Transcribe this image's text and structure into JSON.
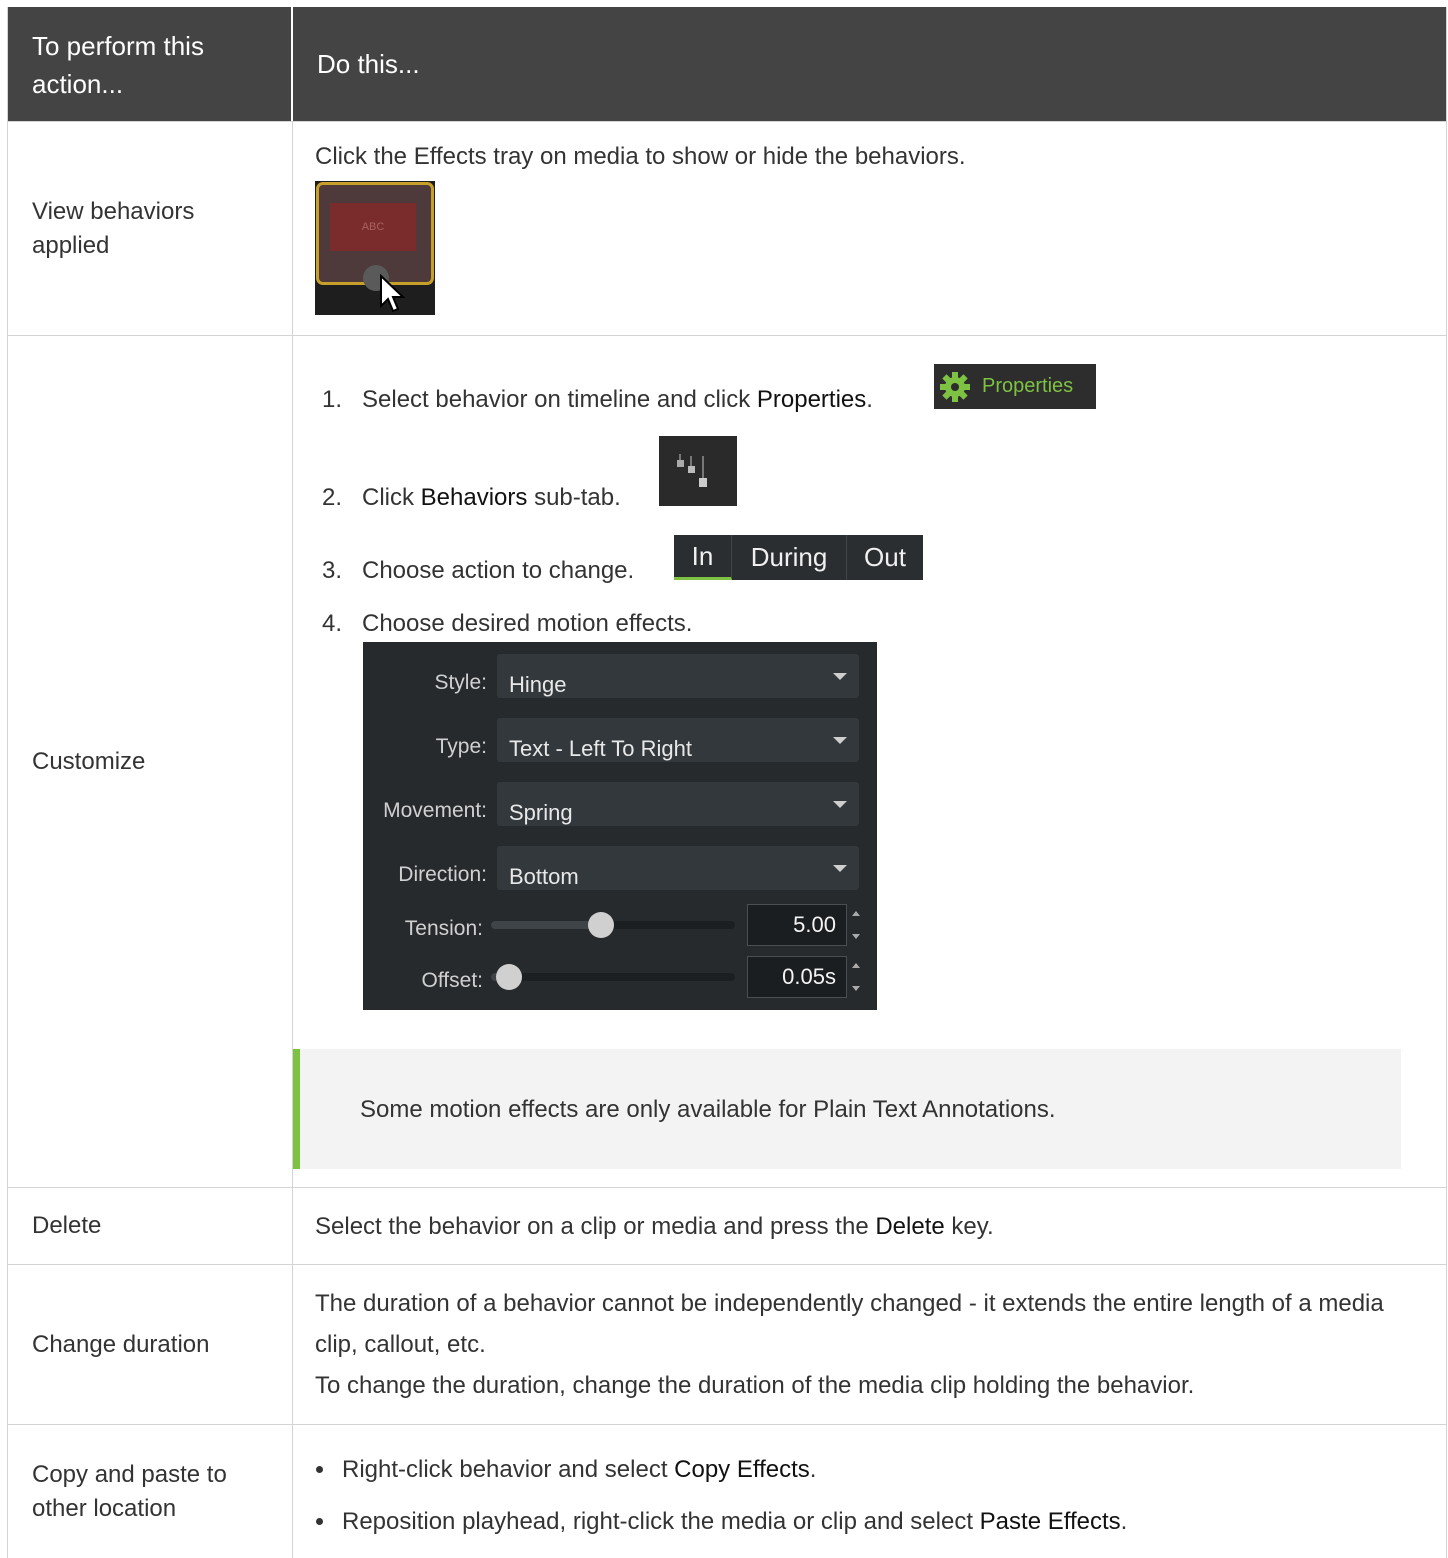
{
  "header": {
    "col1": "To perform this action...",
    "col2": "Do this..."
  },
  "rows": [
    {
      "action": "View behaviors applied",
      "desc": "Click the Effects tray on media to show or hide the behaviors.",
      "thumb_text": "ABC"
    },
    {
      "action": "Customize",
      "steps": [
        {
          "num": "1.",
          "pre": "Select behavior on timeline and click ",
          "bold": "Properties",
          "post": "."
        },
        {
          "num": "2.",
          "pre": "Click ",
          "bold": "Behaviors",
          "post": " sub-tab."
        },
        {
          "num": "3.",
          "pre": "Choose action to change.",
          "bold": "",
          "post": ""
        },
        {
          "num": "4.",
          "pre": "Choose desired motion effects.",
          "bold": "",
          "post": ""
        }
      ],
      "properties_button": "Properties",
      "tabs": [
        "In",
        "During",
        "Out"
      ],
      "panel": {
        "style_label": "Style:",
        "style_value": "Hinge",
        "type_label": "Type:",
        "type_value": "Text - Left To Right",
        "movement_label": "Movement:",
        "movement_value": "Spring",
        "direction_label": "Direction:",
        "direction_value": "Bottom",
        "tension_label": "Tension:",
        "tension_value": "5.00",
        "tension_slider": 0.45,
        "offset_label": "Offset:",
        "offset_value": "0.05s",
        "offset_slider": 0.05
      },
      "note": "Some motion effects are only available for Plain Text Annotations."
    },
    {
      "action": "Delete",
      "pre": "Select the behavior on a clip or media and press the ",
      "bold": "Delete",
      "post": " key."
    },
    {
      "action": "Change duration",
      "line1": "The duration of a behavior cannot be independently changed - it extends the entire length of a media clip, callout, etc.",
      "line2": "To change the duration, change the duration of the media clip holding the behavior."
    },
    {
      "action": "Copy and paste to other location",
      "bullets": [
        {
          "pre": "Right-click behavior and select ",
          "bold": "Copy Effects",
          "post": "."
        },
        {
          "pre": "Reposition playhead, right-click the media or clip and select ",
          "bold": "Paste Effects",
          "post": "."
        }
      ]
    }
  ],
  "colors": {
    "header_bg": "#444444",
    "accent_green": "#7dc242",
    "note_bg": "#f3f3f3"
  }
}
